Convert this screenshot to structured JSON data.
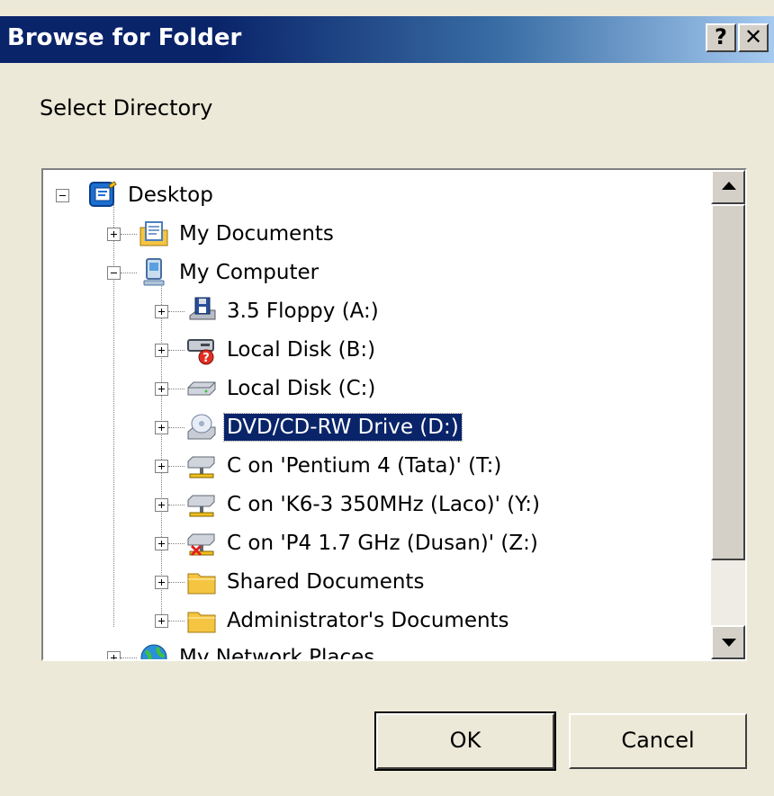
{
  "window": {
    "title": "Browse for Folder",
    "help_label": "?",
    "close_label": "✕"
  },
  "prompt": "Select Directory",
  "tree": {
    "root": "Desktop",
    "items": [
      {
        "label": "My Documents"
      },
      {
        "label": "My Computer"
      },
      {
        "label": "3.5 Floppy (A:)"
      },
      {
        "label": "Local Disk (B:)"
      },
      {
        "label": "Local Disk (C:)"
      },
      {
        "label": "DVD/CD-RW Drive (D:)"
      },
      {
        "label": "C on 'Pentium 4 (Tata)' (T:)"
      },
      {
        "label": "C on 'K6-3 350MHz (Laco)' (Y:)"
      },
      {
        "label": "C on 'P4 1.7 GHz (Dusan)' (Z:)"
      },
      {
        "label": "Shared Documents"
      },
      {
        "label": "Administrator's Documents"
      },
      {
        "label": "My Network Places"
      }
    ],
    "selected": "DVD/CD-RW Drive (D:)"
  },
  "buttons": {
    "ok": "OK",
    "cancel": "Cancel"
  },
  "icons": {
    "desktop": "desktop-icon",
    "my_documents": "documents-folder-icon",
    "my_computer": "computer-icon",
    "floppy": "floppy-drive-icon",
    "local_disk_b": "disk-error-icon",
    "local_disk_c": "hard-disk-icon",
    "dvd": "dvd-drive-icon",
    "network_drive": "network-drive-icon",
    "disconnected_drive": "disconnected-network-drive-icon",
    "folder": "folder-icon",
    "network_places": "network-places-icon"
  }
}
